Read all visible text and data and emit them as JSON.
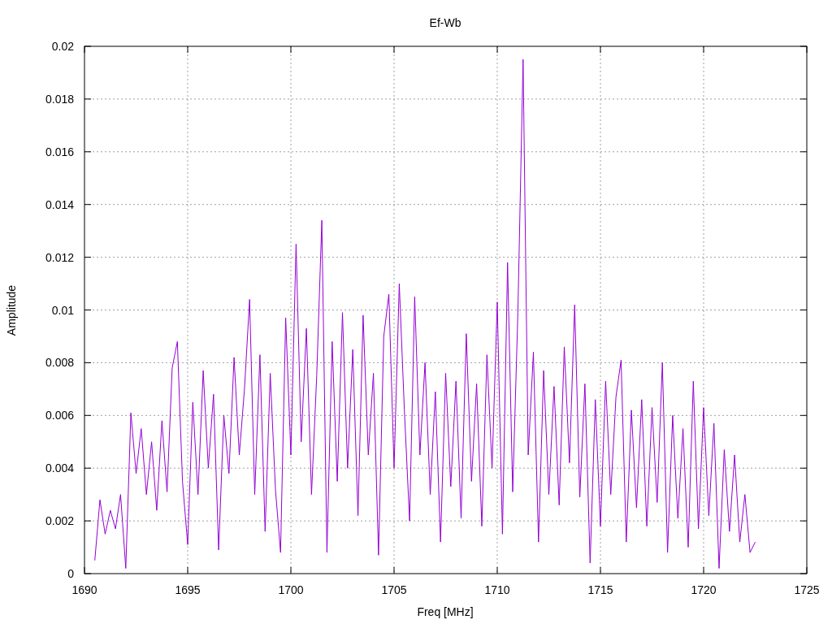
{
  "chart_data": {
    "type": "line",
    "title": "Ef-Wb",
    "xlabel": "Freq [MHz]",
    "ylabel": "Amplitude",
    "xlim": [
      1690,
      1725
    ],
    "ylim": [
      0,
      0.02
    ],
    "xticks": [
      1690,
      1695,
      1700,
      1705,
      1710,
      1715,
      1720,
      1725
    ],
    "yticks": [
      0,
      0.002,
      0.004,
      0.006,
      0.008,
      0.01,
      0.012,
      0.014,
      0.016,
      0.018,
      0.02
    ],
    "x": [
      1690.5,
      1690.75,
      1691,
      1691.25,
      1691.5,
      1691.75,
      1692,
      1692.25,
      1692.5,
      1692.75,
      1693,
      1693.25,
      1693.5,
      1693.75,
      1694,
      1694.25,
      1694.5,
      1694.75,
      1695,
      1695.25,
      1695.5,
      1695.75,
      1696,
      1696.25,
      1696.5,
      1696.75,
      1697,
      1697.25,
      1697.5,
      1697.75,
      1698,
      1698.25,
      1698.5,
      1698.75,
      1699,
      1699.25,
      1699.5,
      1699.75,
      1700,
      1700.25,
      1700.5,
      1700.75,
      1701,
      1701.25,
      1701.5,
      1701.75,
      1702,
      1702.25,
      1702.5,
      1702.75,
      1703,
      1703.25,
      1703.5,
      1703.75,
      1704,
      1704.25,
      1704.5,
      1704.75,
      1705,
      1705.25,
      1705.5,
      1705.75,
      1706,
      1706.25,
      1706.5,
      1706.75,
      1707,
      1707.25,
      1707.5,
      1707.75,
      1708,
      1708.25,
      1708.5,
      1708.75,
      1709,
      1709.25,
      1709.5,
      1709.75,
      1710,
      1710.25,
      1710.5,
      1710.75,
      1711,
      1711.25,
      1711.5,
      1711.75,
      1712,
      1712.25,
      1712.5,
      1712.75,
      1713,
      1713.25,
      1713.5,
      1713.75,
      1714,
      1714.25,
      1714.5,
      1714.75,
      1715,
      1715.25,
      1715.5,
      1715.75,
      1716,
      1716.25,
      1716.5,
      1716.75,
      1717,
      1717.25,
      1717.5,
      1717.75,
      1718,
      1718.25,
      1718.5,
      1718.75,
      1719,
      1719.25,
      1719.5,
      1719.75,
      1720,
      1720.25,
      1720.5,
      1720.75,
      1721,
      1721.25,
      1721.5,
      1721.75,
      1722,
      1722.25,
      1722.5
    ],
    "grid": true,
    "series": [
      {
        "color": "#9400d3",
        "values": [
          0.0005,
          0.0028,
          0.0015,
          0.0024,
          0.0017,
          0.003,
          0.0002,
          0.0061,
          0.0038,
          0.0055,
          0.003,
          0.005,
          0.0024,
          0.0058,
          0.0031,
          0.0078,
          0.0088,
          0.0035,
          0.0011,
          0.0065,
          0.003,
          0.0077,
          0.004,
          0.0068,
          0.0009,
          0.006,
          0.0038,
          0.0082,
          0.0045,
          0.007,
          0.0104,
          0.003,
          0.0083,
          0.0016,
          0.0076,
          0.0032,
          0.0008,
          0.0097,
          0.0045,
          0.0125,
          0.005,
          0.0093,
          0.003,
          0.0075,
          0.0134,
          0.0008,
          0.0088,
          0.0035,
          0.0099,
          0.004,
          0.0085,
          0.0022,
          0.0098,
          0.0045,
          0.0076,
          0.0007,
          0.009,
          0.0106,
          0.004,
          0.011,
          0.0062,
          0.002,
          0.0105,
          0.0045,
          0.008,
          0.003,
          0.0069,
          0.0012,
          0.0076,
          0.0033,
          0.0073,
          0.0021,
          0.0091,
          0.0035,
          0.0072,
          0.0018,
          0.0083,
          0.004,
          0.0103,
          0.0015,
          0.0118,
          0.0031,
          0.0099,
          0.0195,
          0.0045,
          0.0084,
          0.0012,
          0.0077,
          0.003,
          0.0071,
          0.0026,
          0.0086,
          0.0042,
          0.0102,
          0.0029,
          0.0072,
          0.0004,
          0.0066,
          0.0018,
          0.0073,
          0.003,
          0.0067,
          0.0081,
          0.0012,
          0.0062,
          0.0025,
          0.0066,
          0.0018,
          0.0063,
          0.0027,
          0.008,
          0.0008,
          0.006,
          0.0021,
          0.0055,
          0.001,
          0.0073,
          0.0017,
          0.0063,
          0.0022,
          0.0057,
          0.0002,
          0.0047,
          0.0016,
          0.0045,
          0.0012,
          0.003,
          0.0008,
          0.0012
        ]
      }
    ]
  }
}
